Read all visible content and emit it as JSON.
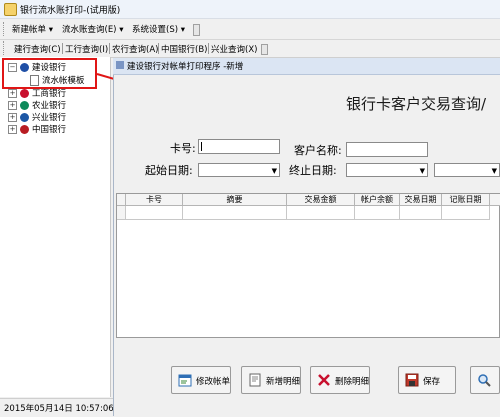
{
  "window": {
    "title": "银行流水账打印-(试用版)"
  },
  "menubar": {
    "items": [
      "新建帐单 ▾",
      "流水账查询(E) ▾",
      "系统设置(S) ▾"
    ]
  },
  "tabs": [
    "建行查询(C)",
    "工行查询(I)",
    "农行查询(A)",
    "中国银行(B)",
    "兴业查询(X)"
  ],
  "tree": {
    "items": [
      {
        "label": "建设银行",
        "expander": "−",
        "color": "#1f4fa6"
      },
      {
        "label": "流水帐模板"
      },
      {
        "label": "工商银行",
        "expander": "+",
        "color": "#c8102e"
      },
      {
        "label": "农业银行",
        "expander": "+",
        "color": "#0d8a5a"
      },
      {
        "label": "兴业银行",
        "expander": "+",
        "color": "#1c57a5"
      },
      {
        "label": "中国银行",
        "expander": "+",
        "color": "#b81c22"
      }
    ]
  },
  "status": {
    "datetime": "2015年05月14日 10:57:06"
  },
  "child": {
    "title": "建设银行对帐单打印程序  -新增",
    "heading": "银行卡客户交易查询/",
    "fields": {
      "card_label": "卡号:",
      "customer_label": "客户名称:",
      "start_label": "起始日期:",
      "end_label": "终止日期:"
    },
    "grid_headers": [
      "卡号",
      "摘要",
      "交易金额",
      "帐户余额",
      "交易日期",
      "记账日期"
    ],
    "buttons": [
      "修改帐单",
      "新增明细",
      "删除明细",
      "保存"
    ]
  },
  "colors": {
    "annotation_red": "#e01616"
  }
}
